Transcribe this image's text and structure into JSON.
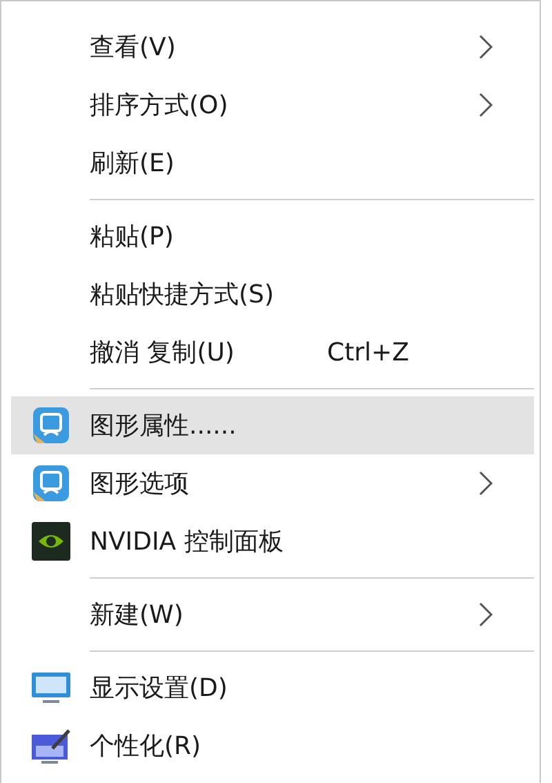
{
  "menu": {
    "items": [
      {
        "kind": "plain",
        "label": "查看(V)",
        "submenu": true,
        "selected": false
      },
      {
        "kind": "plain",
        "label": "排序方式(O)",
        "submenu": true,
        "selected": false
      },
      {
        "kind": "plain",
        "label": "刷新(E)",
        "submenu": false,
        "selected": false
      },
      {
        "kind": "separator"
      },
      {
        "kind": "plain",
        "label": "粘贴(P)",
        "submenu": false,
        "selected": false
      },
      {
        "kind": "plain",
        "label": "粘贴快捷方式(S)",
        "submenu": false,
        "selected": false
      },
      {
        "kind": "plain",
        "label": "撤消 复制(U)",
        "shortcut": "Ctrl+Z",
        "submenu": false,
        "selected": false
      },
      {
        "kind": "separator"
      },
      {
        "kind": "graphics",
        "label": "图形属性......",
        "submenu": false,
        "selected": true
      },
      {
        "kind": "graphics",
        "label": "图形选项",
        "submenu": true,
        "selected": false
      },
      {
        "kind": "nvidia",
        "label": "NVIDIA 控制面板",
        "submenu": false,
        "selected": false
      },
      {
        "kind": "separator"
      },
      {
        "kind": "plain",
        "label": "新建(W)",
        "submenu": true,
        "selected": false
      },
      {
        "kind": "separator"
      },
      {
        "kind": "display",
        "label": "显示设置(D)",
        "submenu": false,
        "selected": false
      },
      {
        "kind": "personalize",
        "label": "个性化(R)",
        "submenu": false,
        "selected": false
      }
    ]
  }
}
